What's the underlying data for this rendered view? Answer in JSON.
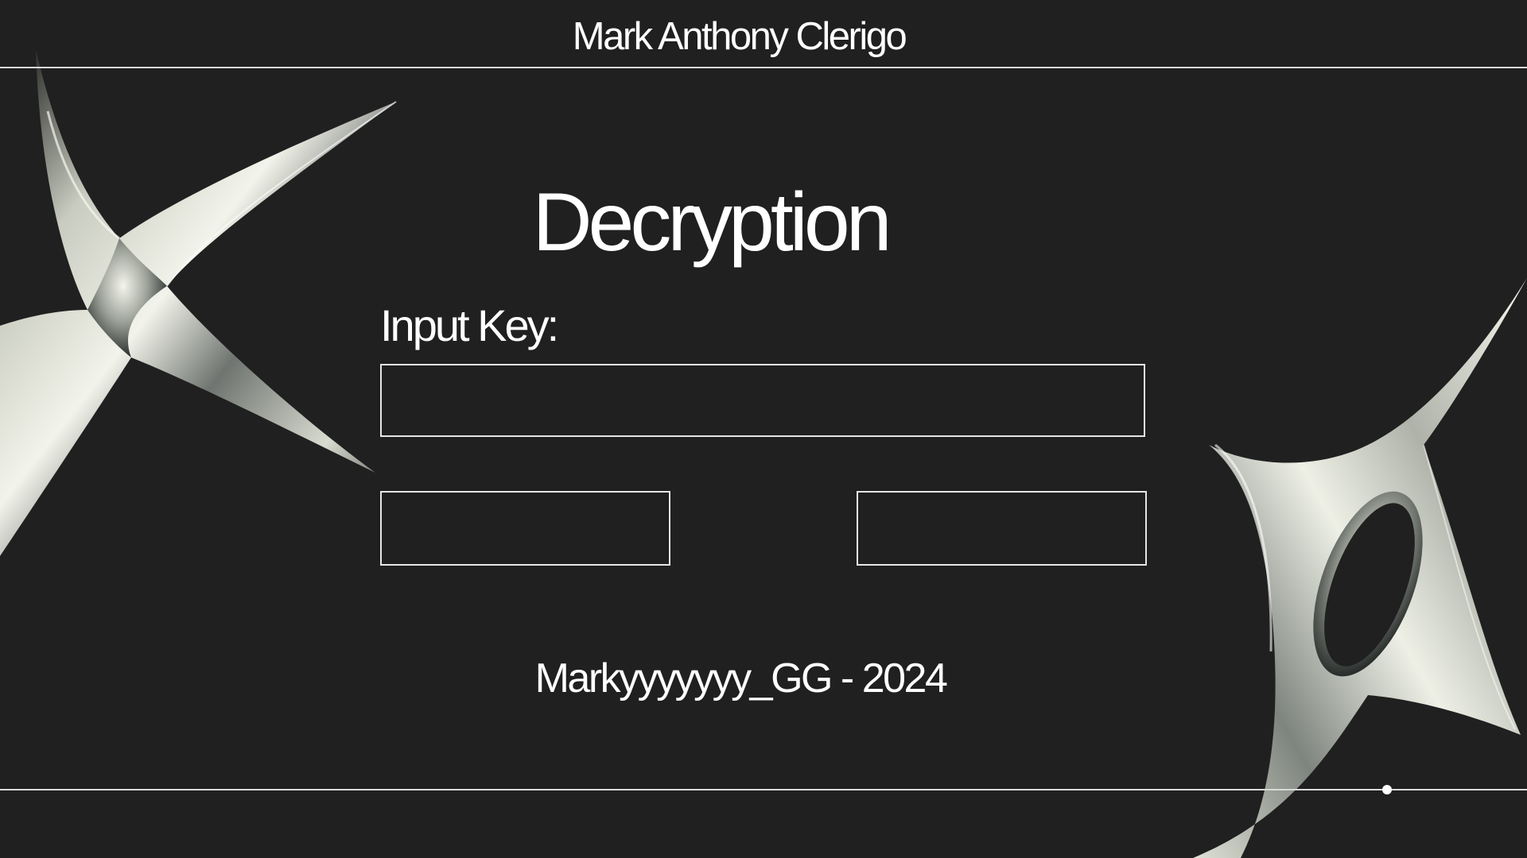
{
  "header": {
    "author_name": "Mark Anthony Clerigo"
  },
  "main": {
    "title": "Decryption",
    "key_label": "Input Key:",
    "key_input_value": "",
    "key_input_placeholder": "",
    "left_button_label": "",
    "right_button_label": ""
  },
  "footer": {
    "credit": "Markyyyyyyy_GG - 2024"
  },
  "decorations": {
    "left_shape": "chrome-star-icon",
    "right_shape": "chrome-sparkle-ring-icon"
  },
  "colors": {
    "background": "#202020",
    "text": "#ffffff",
    "border": "#e6e6e6"
  }
}
